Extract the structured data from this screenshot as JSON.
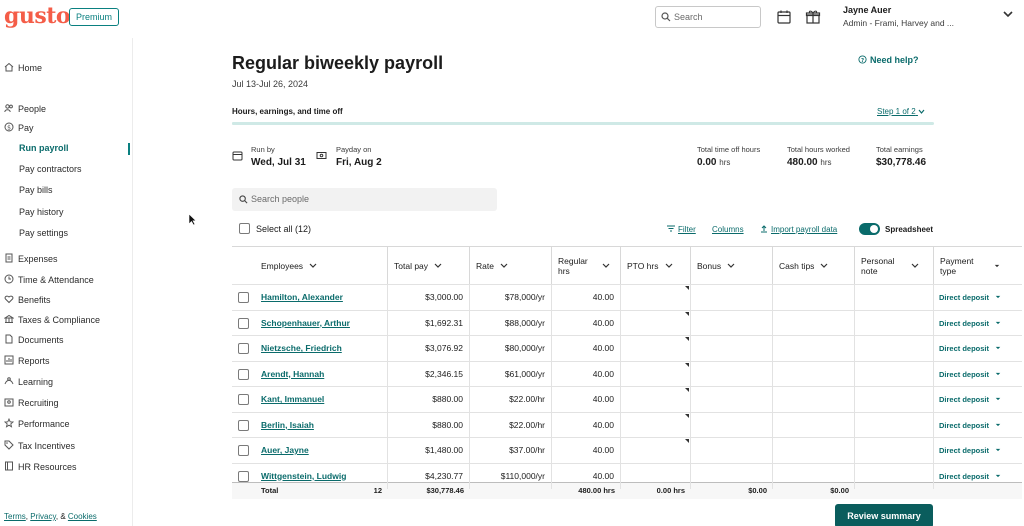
{
  "header": {
    "logo": "gusto",
    "plan_badge": "Premium",
    "search_placeholder": "Search",
    "user_name": "Jayne Auer",
    "user_role": "Admin - Frami, Harvey and ..."
  },
  "sidebar": {
    "items": [
      {
        "label": "Home",
        "icon": "home-icon"
      },
      {
        "label": "People",
        "icon": "people-icon"
      },
      {
        "label": "Pay",
        "icon": "dollar-icon"
      },
      {
        "label": "Run payroll",
        "sub": true,
        "active": true
      },
      {
        "label": "Pay contractors",
        "sub": true
      },
      {
        "label": "Pay bills",
        "sub": true
      },
      {
        "label": "Pay history",
        "sub": true
      },
      {
        "label": "Pay settings",
        "sub": true
      },
      {
        "label": "Expenses",
        "icon": "receipt-icon"
      },
      {
        "label": "Time & Attendance",
        "icon": "clock-icon"
      },
      {
        "label": "Benefits",
        "icon": "heart-icon"
      },
      {
        "label": "Taxes & Compliance",
        "icon": "bank-icon"
      },
      {
        "label": "Documents",
        "icon": "document-icon"
      },
      {
        "label": "Reports",
        "icon": "chart-icon"
      },
      {
        "label": "Learning",
        "icon": "learning-icon"
      },
      {
        "label": "Recruiting",
        "icon": "recruiting-icon"
      },
      {
        "label": "Performance",
        "icon": "star-icon"
      },
      {
        "label": "Tax Incentives",
        "icon": "tag-icon"
      },
      {
        "label": "HR Resources",
        "icon": "book-icon"
      }
    ],
    "footer": {
      "terms": "Terms",
      "sep1": ", ",
      "privacy": "Privacy",
      "sep2": ", & ",
      "cookies": "Cookies"
    }
  },
  "main": {
    "title": "Regular biweekly payroll",
    "date_range": "Jul 13-Jul 26, 2024",
    "need_help": "Need help?",
    "step_title": "Hours, earnings, and time off",
    "step_link": "Step 1 of 2",
    "step_progress": 0.5,
    "run_by_label": "Run by",
    "run_by_value": "Wed, Jul 31",
    "payday_label": "Payday on",
    "payday_value": "Fri, Aug 2",
    "time_off_label": "Total time off hours",
    "time_off_value": "0.00",
    "time_off_unit": "hrs",
    "hours_label": "Total hours worked",
    "hours_value": "480.00",
    "hours_unit": "hrs",
    "earnings_label": "Total earnings",
    "earnings_value": "$30,778.46",
    "search_people_placeholder": "Search people",
    "select_all": "Select all (12)",
    "filter": "Filter",
    "columns": "Columns",
    "import": "Import payroll data",
    "spreadsheet": "Spreadsheet",
    "review_button": "Review summary"
  },
  "table": {
    "headers": [
      "Employees",
      "Total pay",
      "Rate",
      "Regular hrs",
      "PTO hrs",
      "Bonus",
      "Cash tips",
      "Personal note",
      "Payment type"
    ],
    "rows": [
      {
        "name": "Hamilton, Alexander",
        "total": "$3,000.00",
        "rate": "$78,000/yr",
        "hours": "40.00",
        "payment": "Direct deposit"
      },
      {
        "name": "Schopenhauer, Arthur",
        "total": "$1,692.31",
        "rate": "$88,000/yr",
        "hours": "40.00",
        "payment": "Direct deposit"
      },
      {
        "name": "Nietzsche, Friedrich",
        "total": "$3,076.92",
        "rate": "$80,000/yr",
        "hours": "40.00",
        "payment": "Direct deposit"
      },
      {
        "name": "Arendt, Hannah",
        "total": "$2,346.15",
        "rate": "$61,000/yr",
        "hours": "40.00",
        "payment": "Direct deposit"
      },
      {
        "name": "Kant, Immanuel",
        "total": "$880.00",
        "rate": "$22.00/hr",
        "hours": "40.00",
        "payment": "Direct deposit"
      },
      {
        "name": "Berlin, Isaiah",
        "total": "$880.00",
        "rate": "$22.00/hr",
        "hours": "40.00",
        "payment": "Direct deposit"
      },
      {
        "name": "Auer, Jayne",
        "total": "$1,480.00",
        "rate": "$37.00/hr",
        "hours": "40.00",
        "payment": "Direct deposit"
      },
      {
        "name": "Wittgenstein, Ludwig",
        "total": "$4,230.77",
        "rate": "$110,000/yr",
        "hours": "40.00",
        "payment": "Direct deposit"
      }
    ],
    "total": {
      "label": "Total",
      "count": "12",
      "pay": "$30,778.46",
      "regular": "480.00 hrs",
      "pto": "0.00 hrs",
      "bonus": "$0.00",
      "tips": "$0.00"
    }
  }
}
